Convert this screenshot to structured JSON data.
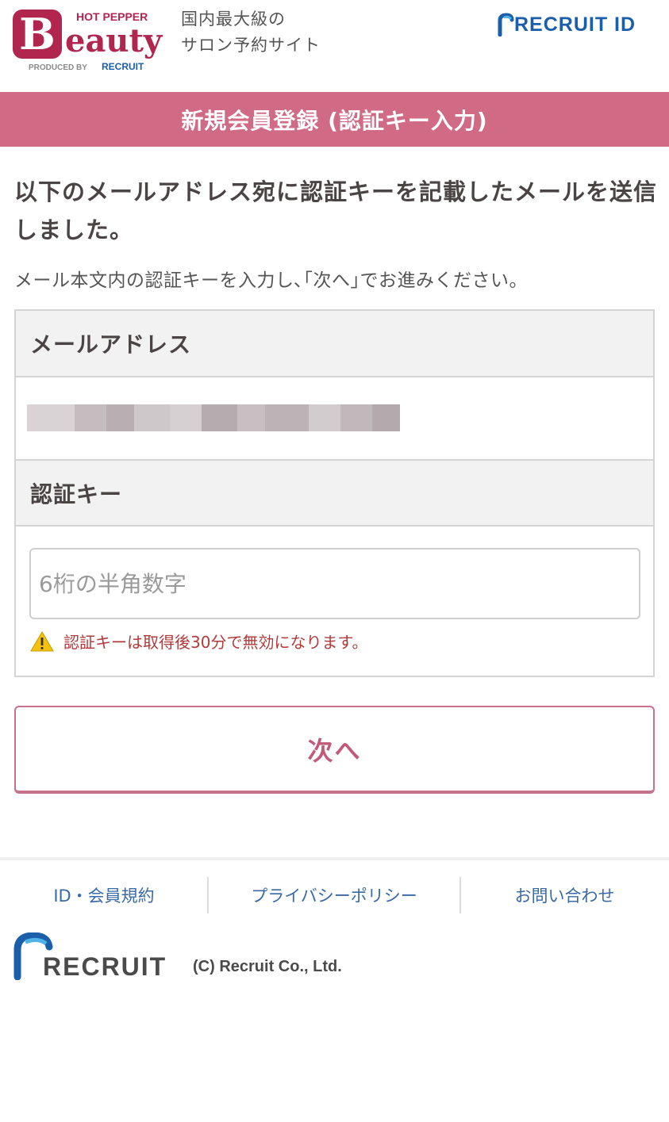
{
  "header": {
    "brand_small": "HOT PEPPER",
    "brand_main": "Beauty",
    "brand_produced": "PRODUCED BY",
    "brand_produced_logo": "RECRUIT",
    "tagline_line1": "国内最大級の",
    "tagline_line2": "サロン予約サイト",
    "recruit_id_label": "RECRUIT ID"
  },
  "title_bar": {
    "title": "新規会員登録 (認証キー入力)"
  },
  "main": {
    "lead": "以下のメールアドレス宛に認証キーを記載したメールを送信しました。",
    "instruction": "メール本文内の認証キーを入力し､｢次へ｣でお進みください。",
    "email_label": "メールアドレス",
    "key_label": "認証キー",
    "key_placeholder": "6桁の半角数字",
    "key_value": "",
    "warning": "認証キーは取得後30分で無効になります。",
    "next_button": "次へ"
  },
  "footer": {
    "links": [
      "ID・会員規約",
      "プライバシーポリシー",
      "お問い合わせ"
    ],
    "logo_text": "RECRUIT",
    "copyright": "(C) Recruit Co., Ltd."
  },
  "icons": {
    "warning": "warning-triangle-icon"
  },
  "colors": {
    "title_bar_bg": "#d16a85",
    "button_text": "#c05a78",
    "link_blue": "#3a6aa6",
    "warning_red": "#b23a3a",
    "brand_crimson": "#b0264f"
  }
}
